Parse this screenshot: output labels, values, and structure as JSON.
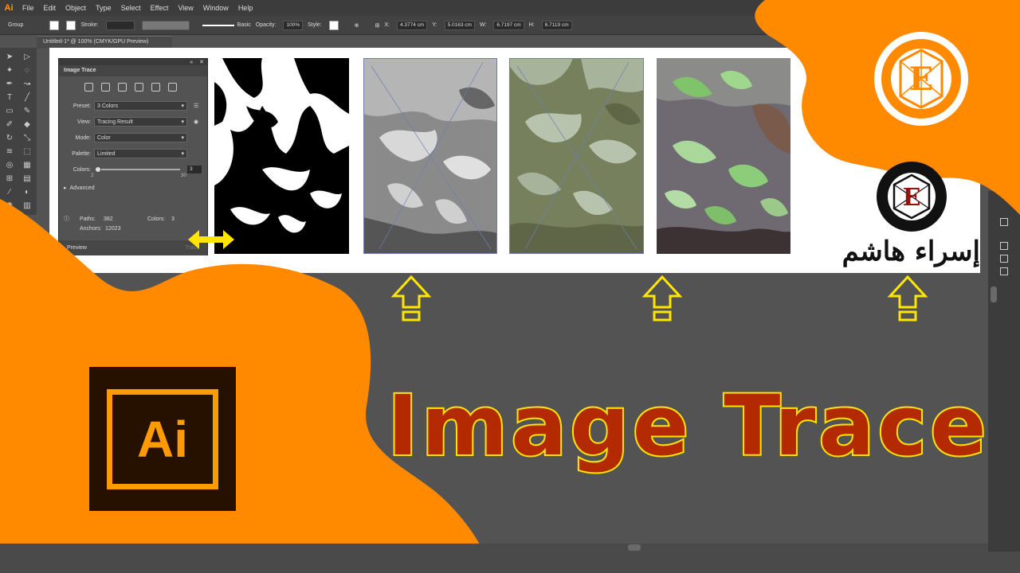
{
  "menu": {
    "logo": "Ai",
    "items": [
      "File",
      "Edit",
      "Object",
      "Type",
      "Select",
      "Effect",
      "View",
      "Window",
      "Help"
    ]
  },
  "control_bar": {
    "selection": "Group",
    "stroke_label": "Stroke:",
    "basic_label": "Basic",
    "opacity_label": "Opacity:",
    "opacity_value": "100%",
    "style_label": "Style:",
    "x_label": "X:",
    "x_value": "4.3774 cm",
    "y_label": "Y:",
    "y_value": "5.0163 cm",
    "w_label": "W:",
    "w_value": "6.7197 cm",
    "h_label": "H:",
    "h_value": "6.7119 cm"
  },
  "document_tab": "Untitled-1* @ 100% (CMYK/GPU Preview)",
  "image_trace_panel": {
    "title": "Image Trace",
    "preset_label": "Preset:",
    "preset_value": "3 Colors",
    "view_label": "View:",
    "view_value": "Tracing Result",
    "mode_label": "Mode:",
    "mode_value": "Color",
    "palette_label": "Palette:",
    "palette_value": "Limited",
    "colors_label": "Colors:",
    "colors_value": "3",
    "slider_min": "2",
    "slider_max": "30",
    "advanced_label": "Advanced",
    "paths_label": "Paths:",
    "paths_value": "382",
    "colors_stat_label": "Colors:",
    "colors_stat_value": "3",
    "anchors_label": "Anchors:",
    "anchors_value": "12023",
    "preview_label": "Preview",
    "trace_label": "Trace"
  },
  "title": "Image Trace",
  "app_logo_text": "Ai",
  "channel_logo_letter": "E",
  "author_name": "إسراء هاشم",
  "colors": {
    "accent_orange": "#ff8a00",
    "title_fill": "#b42a00",
    "title_stroke": "#ffe600",
    "arrow_yellow": "#ffe600",
    "ai_logo_bg": "#261100",
    "ai_logo_orange": "#ff9a00"
  }
}
